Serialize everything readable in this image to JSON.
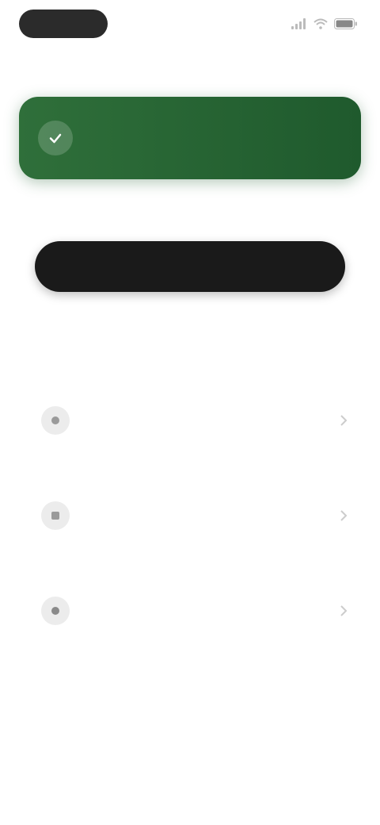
{
  "status_bar": {
    "time": "",
    "icons": [
      "signal-icon",
      "wifi-icon",
      "battery-icon"
    ]
  },
  "header": {
    "left_label": "",
    "right_label": ""
  },
  "banner": {
    "icon": "check-icon",
    "title": "",
    "subtitle": "",
    "color": "#2f6f3a"
  },
  "section": {
    "label": ""
  },
  "primary_button": {
    "label": "",
    "color": "#1a1a1a"
  },
  "secondary_link": {
    "label": ""
  },
  "list": {
    "items": [
      {
        "icon": "item-icon",
        "title": "",
        "subtitle": ""
      },
      {
        "icon": "item-icon",
        "title": "",
        "subtitle": ""
      },
      {
        "icon": "item-icon",
        "title": "",
        "subtitle": ""
      }
    ]
  }
}
